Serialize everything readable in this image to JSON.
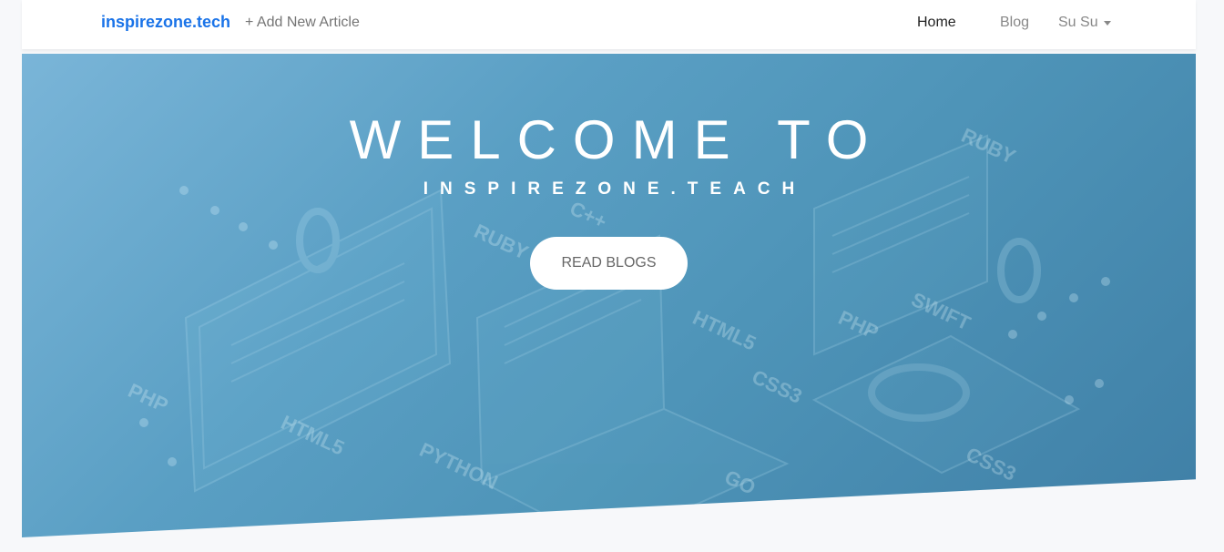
{
  "navbar": {
    "brand": "inspirezone.tech",
    "add_article": "+ Add New Article",
    "home": "Home",
    "blog": "Blog",
    "user": "Su Su"
  },
  "hero": {
    "title": "WELCOME TO",
    "subtitle": "INSPIREZONE.TEACH",
    "button": "READ BLOGS",
    "background_labels": [
      "RUBY",
      "RUBY",
      "C++",
      "HTML5",
      "CSS3",
      "PHP",
      "SWIFT",
      "PHP",
      "HTML5",
      "PYTHON",
      "GO",
      "CSS3"
    ]
  }
}
